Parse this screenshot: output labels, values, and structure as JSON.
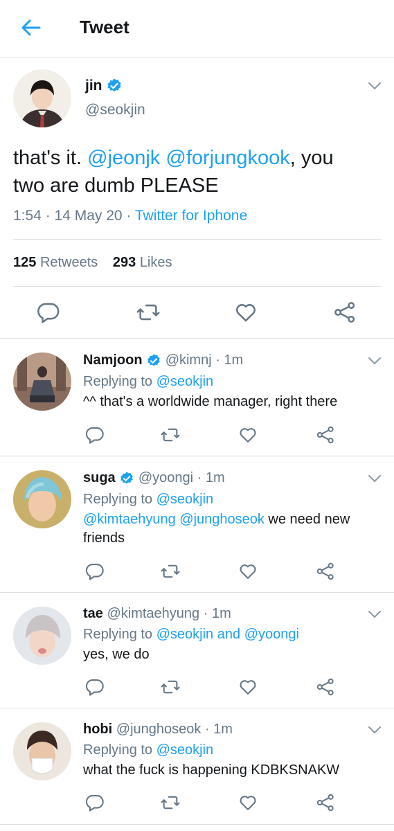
{
  "header": {
    "title": "Tweet"
  },
  "main_tweet": {
    "name": "jin",
    "handle": "@seokjin",
    "text_start": "that's it. ",
    "mention_1": "@jeonjk",
    "mention_2": "@forjungkook",
    "text_mid": ", you",
    "text_line2": "two are dumb PLEASE",
    "time": "1:54 · 14 May 20 · ",
    "source": "Twitter for Iphone",
    "retweet_count": "125",
    "retweet_label": "Retweets",
    "like_count": "293",
    "like_label": "Likes"
  },
  "replies": [
    {
      "name": "Namjoon",
      "handle_time": "@kimnj · 1m",
      "replying_label": "Replying to ",
      "replying_to": "@seokjin",
      "text": "^^ that's a worldwide manager, right there"
    },
    {
      "name": "suga",
      "handle_time": "@yoongi · 1m",
      "replying_label": "Replying to ",
      "replying_to": "@seokjin",
      "mention_1": "@kimtaehyung",
      "mention_2": "@junghoseok",
      "text": " we need new",
      "text_line2": "friends"
    },
    {
      "name": "tae",
      "handle_time": "@kimtaehyung · 1m",
      "replying_label": "Replying to ",
      "replying_to": "@seokjin and @yoongi",
      "text": "yes, we do"
    },
    {
      "name": "hobi",
      "handle_time": "@junghoseok · 1m",
      "replying_label": "Replying to ",
      "replying_to": "@seokjin",
      "text": "what the fuck is happening KDBKSNAKW"
    }
  ],
  "colors": {
    "accent": "#1da1f2",
    "muted": "#657786",
    "text": "#14171a",
    "divider": "#dcdfe2"
  },
  "icons": [
    "back-arrow-icon",
    "verified-badge-icon",
    "chevron-down-icon",
    "reply-icon",
    "retweet-icon",
    "like-icon",
    "share-icon"
  ]
}
